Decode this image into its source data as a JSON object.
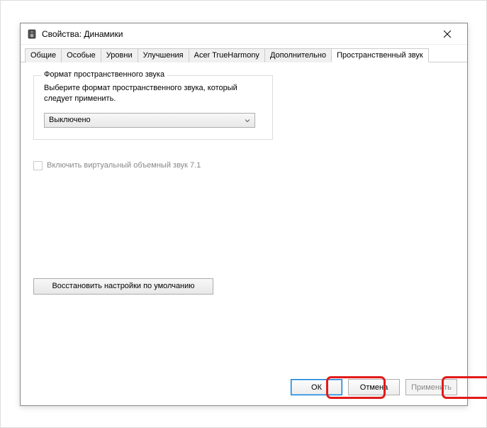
{
  "titlebar": {
    "title": "Свойства: Динамики"
  },
  "tabs": [
    {
      "label": "Общие"
    },
    {
      "label": "Особые"
    },
    {
      "label": "Уровни"
    },
    {
      "label": "Улучшения"
    },
    {
      "label": "Acer TrueHarmony"
    },
    {
      "label": "Дополнительно"
    },
    {
      "label": "Пространственный звук",
      "active": true
    }
  ],
  "group": {
    "title": "Формат пространственного звука",
    "text": "Выберите формат пространственного звука, который следует применить."
  },
  "dropdown": {
    "value": "Выключено"
  },
  "checkbox": {
    "label": "Включить виртуальный объемный звук 7.1"
  },
  "restore_button": "Восстановить настройки по умолчанию",
  "buttons": {
    "ok": "ОК",
    "cancel": "Отмена",
    "apply": "Применить"
  }
}
